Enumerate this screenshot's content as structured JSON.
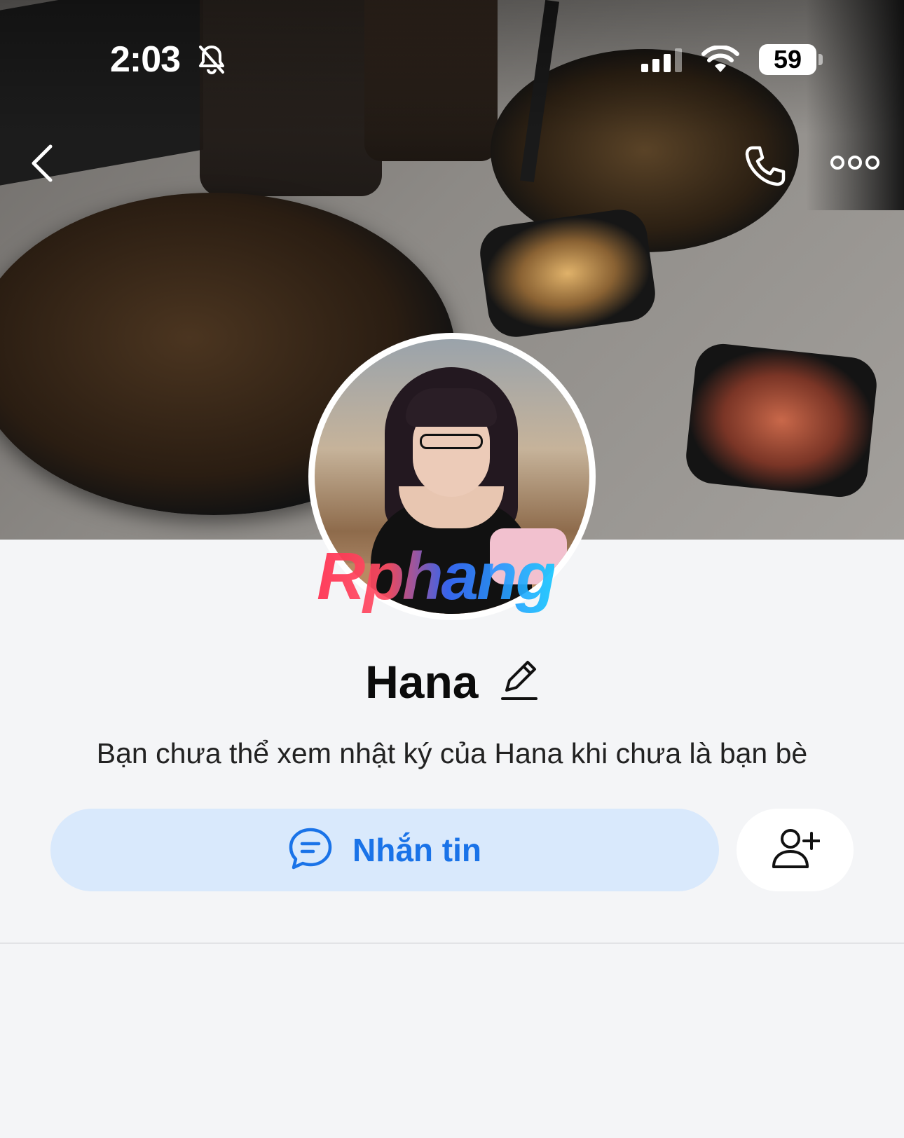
{
  "status_bar": {
    "time": "2:03",
    "battery": "59",
    "icons": [
      "bell-slash-icon",
      "cellular-signal-icon",
      "wifi-icon",
      "battery-icon"
    ]
  },
  "top_bar": {
    "icons": [
      "chevron-left-icon",
      "phone-icon",
      "more-horizontal-icon"
    ]
  },
  "watermark": "Rphang",
  "profile": {
    "name": "Hana",
    "privacy_text": "Bạn chưa thể xem nhật ký của Hana khi chưa là bạn bè"
  },
  "actions": {
    "message_label": "Nhắn tin",
    "message_icon": "chat-bubble-icon",
    "add_friend_icon": "user-plus-icon"
  },
  "colors": {
    "accent": "#1a73e8",
    "message_button_bg": "#d9e9fc",
    "background": "#f4f5f7"
  }
}
